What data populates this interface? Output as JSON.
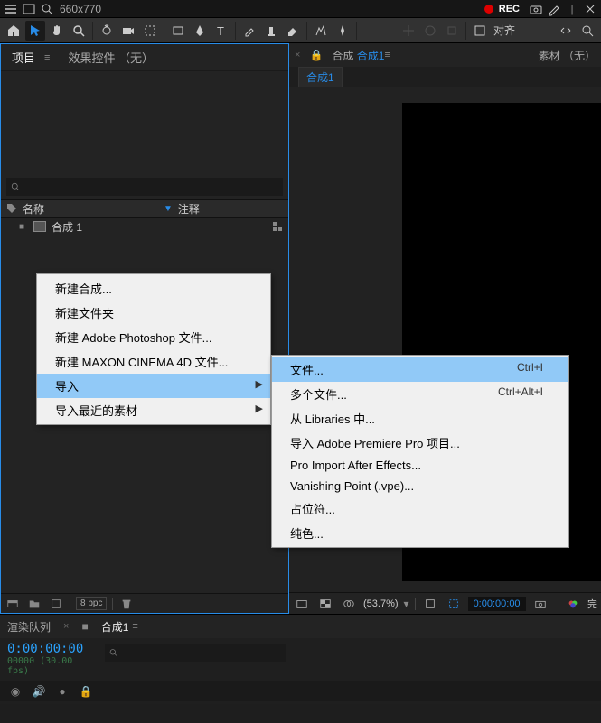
{
  "topbar": {
    "search_text": "660x770",
    "rec_label": "REC"
  },
  "toolbar": {
    "snap_label": "对齐"
  },
  "project": {
    "tab_project": "项目",
    "tab_effect_controls": "效果控件 （无）",
    "search_placeholder": "",
    "col_name": "名称",
    "col_comment": "注释",
    "item_name": "合成 1",
    "bpc": "8 bpc"
  },
  "comp": {
    "bc_prefix": "合成",
    "bc_name": "合成1",
    "crumb": "合成1",
    "material_tab": "素材 （无）",
    "zoom": "(53.7%)",
    "time": "0:00:00:00",
    "done": "完"
  },
  "timeline": {
    "tab_render": "渲染队列",
    "tab_comp": "合成1",
    "time": "0:00:00:00",
    "fps": "00000 (30.00 fps)"
  },
  "context1": {
    "new_comp": "新建合成...",
    "new_folder": "新建文件夹",
    "new_ps": "新建 Adobe Photoshop 文件...",
    "new_c4d": "新建 MAXON CINEMA 4D 文件...",
    "import": "导入",
    "recent": "导入最近的素材"
  },
  "context2": {
    "file": "文件...",
    "file_shortcut": "Ctrl+I",
    "multiple": "多个文件...",
    "multiple_shortcut": "Ctrl+Alt+I",
    "libraries": "从 Libraries 中...",
    "premiere": "导入 Adobe Premiere Pro 项目...",
    "pro_import": "Pro Import After Effects...",
    "vpe": "Vanishing Point (.vpe)...",
    "placeholder": "占位符...",
    "solid": "纯色..."
  }
}
